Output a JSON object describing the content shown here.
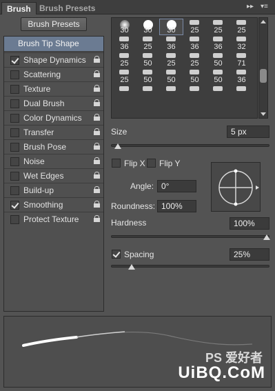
{
  "tabs": [
    "Brush",
    "Brush Presets"
  ],
  "toolbar": {
    "presets_button": "Brush Presets"
  },
  "left_list": {
    "selected": "Brush Tip Shape",
    "items": [
      {
        "label": "Shape Dynamics",
        "checked": true
      },
      {
        "label": "Scattering",
        "checked": false
      },
      {
        "label": "Texture",
        "checked": false
      },
      {
        "label": "Dual Brush",
        "checked": false
      },
      {
        "label": "Color Dynamics",
        "checked": false
      },
      {
        "label": "Transfer",
        "checked": false
      },
      {
        "label": "Brush Pose",
        "checked": false
      },
      {
        "label": "Noise",
        "checked": false
      },
      {
        "label": "Wet Edges",
        "checked": false
      },
      {
        "label": "Build-up",
        "checked": false
      },
      {
        "label": "Smoothing",
        "checked": true
      },
      {
        "label": "Protect Texture",
        "checked": false
      }
    ]
  },
  "brush_grid": {
    "rows": [
      [
        "30",
        "30",
        "30",
        "25",
        "25",
        "25"
      ],
      [
        "36",
        "25",
        "36",
        "36",
        "36",
        "32"
      ],
      [
        "25",
        "50",
        "25",
        "25",
        "50",
        "71"
      ],
      [
        "25",
        "50",
        "50",
        "50",
        "50",
        "36"
      ],
      [
        "",
        "",
        "",
        "",
        "",
        ""
      ]
    ],
    "selected_index": 2
  },
  "size": {
    "label": "Size",
    "value": "5 px",
    "slider_pct": 0.02
  },
  "flip": {
    "x_label": "Flip X",
    "y_label": "Flip Y"
  },
  "angle": {
    "label": "Angle:",
    "value": "0°"
  },
  "roundness": {
    "label": "Roundness:",
    "value": "100%"
  },
  "hardness": {
    "label": "Hardness",
    "value": "100%",
    "slider_pct": 1.0
  },
  "spacing": {
    "label": "Spacing",
    "value": "25%",
    "checked": true,
    "slider_pct": 0.11
  },
  "watermark": {
    "line1": "PS 爱好者",
    "line2": "UiBQ.CoM"
  }
}
